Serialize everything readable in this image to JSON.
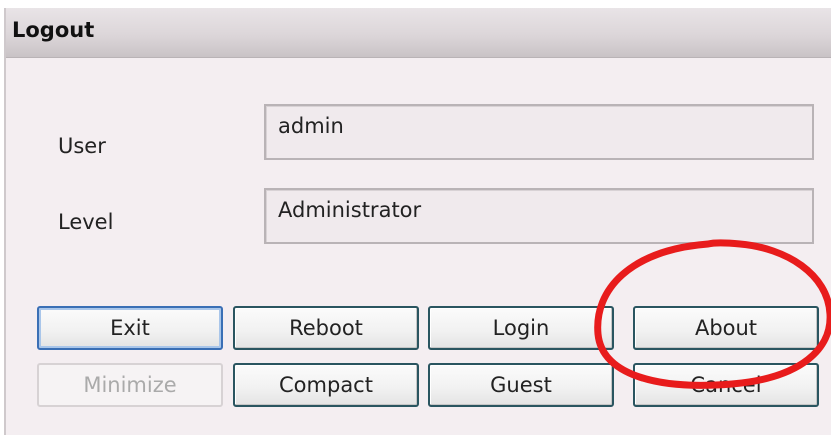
{
  "window": {
    "title": "Logout"
  },
  "fields": {
    "user": {
      "label": "User",
      "value": "admin"
    },
    "level": {
      "label": "Level",
      "value": "Administrator"
    }
  },
  "buttons": {
    "exit": "Exit",
    "reboot": "Reboot",
    "login": "Login",
    "about": "About",
    "minimize": "Minimize",
    "compact": "Compact",
    "guest": "Guest",
    "cancel": "Cancel"
  },
  "annotation": {
    "ring_color": "#e81c1c"
  }
}
